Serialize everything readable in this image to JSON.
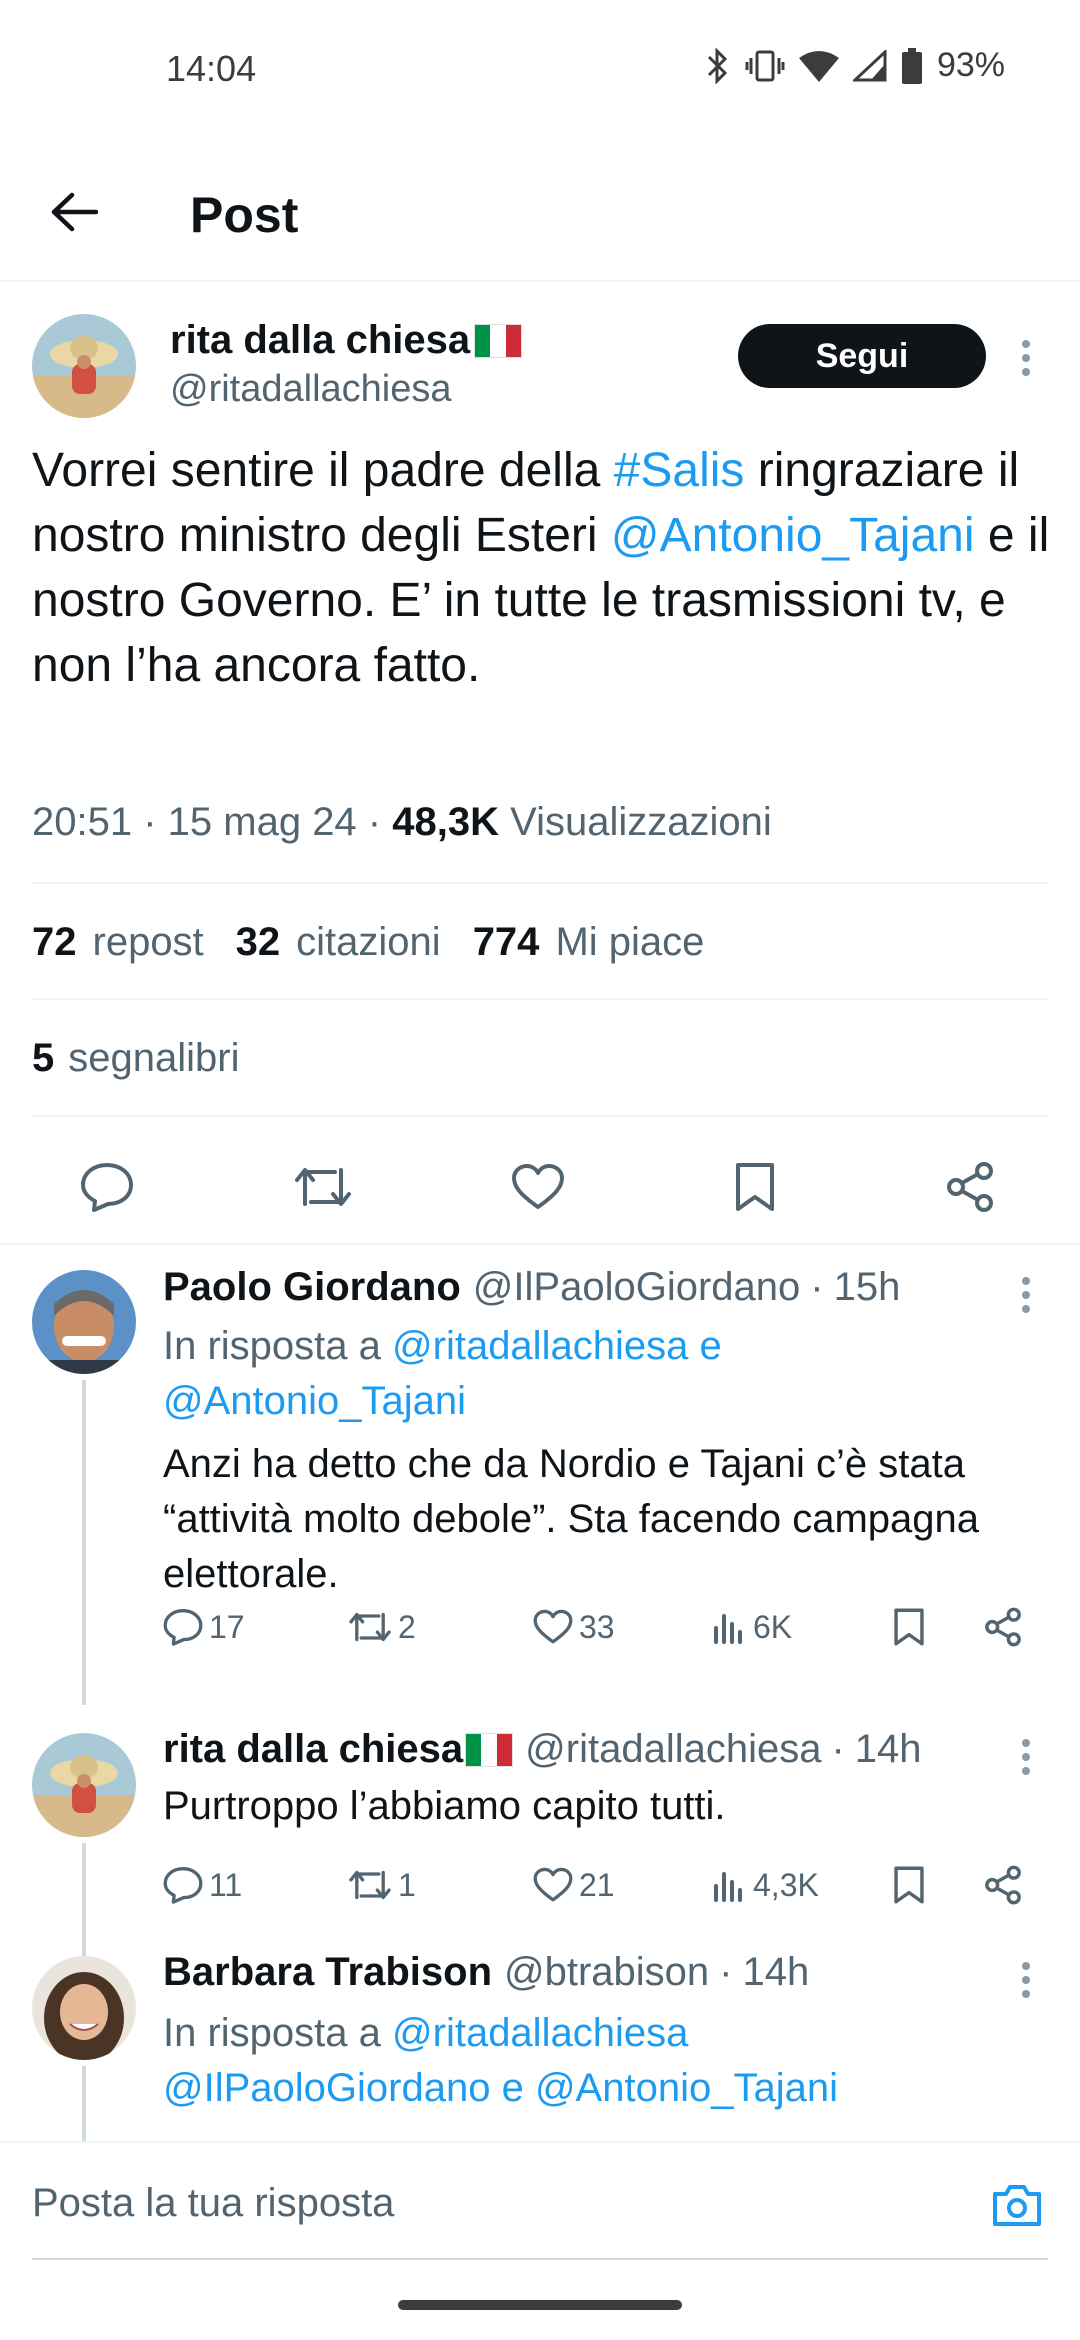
{
  "status_bar": {
    "time": "14:04",
    "battery": "93%",
    "icons": [
      "bluetooth-icon",
      "vibrate-icon",
      "wifi-icon",
      "signal-icon",
      "battery-icon"
    ]
  },
  "header": {
    "title": "Post",
    "back_icon": "arrow-left-icon"
  },
  "main_tweet": {
    "author_name": "rita dalla chiesa",
    "author_handle": "@ritadallachiesa",
    "follow_label": "Segui",
    "text_parts": {
      "p1": "Vorrei sentire il padre della ",
      "hashtag": "#Salis",
      "p2": " ringraziare il nostro ministro degli Esteri ",
      "mention": "@Antonio_Tajani",
      "p3": " e il nostro Governo. E’ in tutte le trasmissioni tv, e non l’ha ancora fatto."
    },
    "time": "20:51",
    "date": "15 mag 24",
    "views_count": "48,3K",
    "views_label": "Visualizzazioni",
    "reposts_count": "72",
    "reposts_label": "repost",
    "quotes_count": "32",
    "quotes_label": "citazioni",
    "likes_count": "774",
    "likes_label": "Mi piace",
    "bookmarks_count": "5",
    "bookmarks_label": "segnalibri"
  },
  "replies": [
    {
      "name": "Paolo Giordano",
      "handle": "@IlPaoloGiordano",
      "time": "15h",
      "reply_prefix": "In risposta a ",
      "reply_mention1": "@ritadallachiesa",
      "reply_joiner": " e",
      "reply_mention2": "@Antonio_Tajani",
      "text": "Anzi ha detto che da Nordio e Tajani c’è stata “attività molto debole”. Sta facendo campagna elettorale.",
      "replies": "17",
      "reposts": "2",
      "likes": "33",
      "views": "6K"
    },
    {
      "name": "rita dalla chiesa",
      "handle": "@ritadallachiesa",
      "time": "14h",
      "text": "Purtroppo l’abbiamo capito tutti.",
      "replies": "11",
      "reposts": "1",
      "likes": "21",
      "views": "4,3K"
    },
    {
      "name": "Barbara Trabison",
      "handle": "@btrabison",
      "time": "14h",
      "reply_prefix": "In risposta a ",
      "reply_mention1": "@ritadallachiesa",
      "reply_mention2": "@IlPaoloGiordano",
      "reply_joiner": " e ",
      "reply_mention3": "@Antonio_Tajani"
    }
  ],
  "composer": {
    "placeholder": "Posta la tua risposta"
  },
  "colors": {
    "accent": "#1d9bf0",
    "text": "#0f1419",
    "muted": "#536471"
  }
}
